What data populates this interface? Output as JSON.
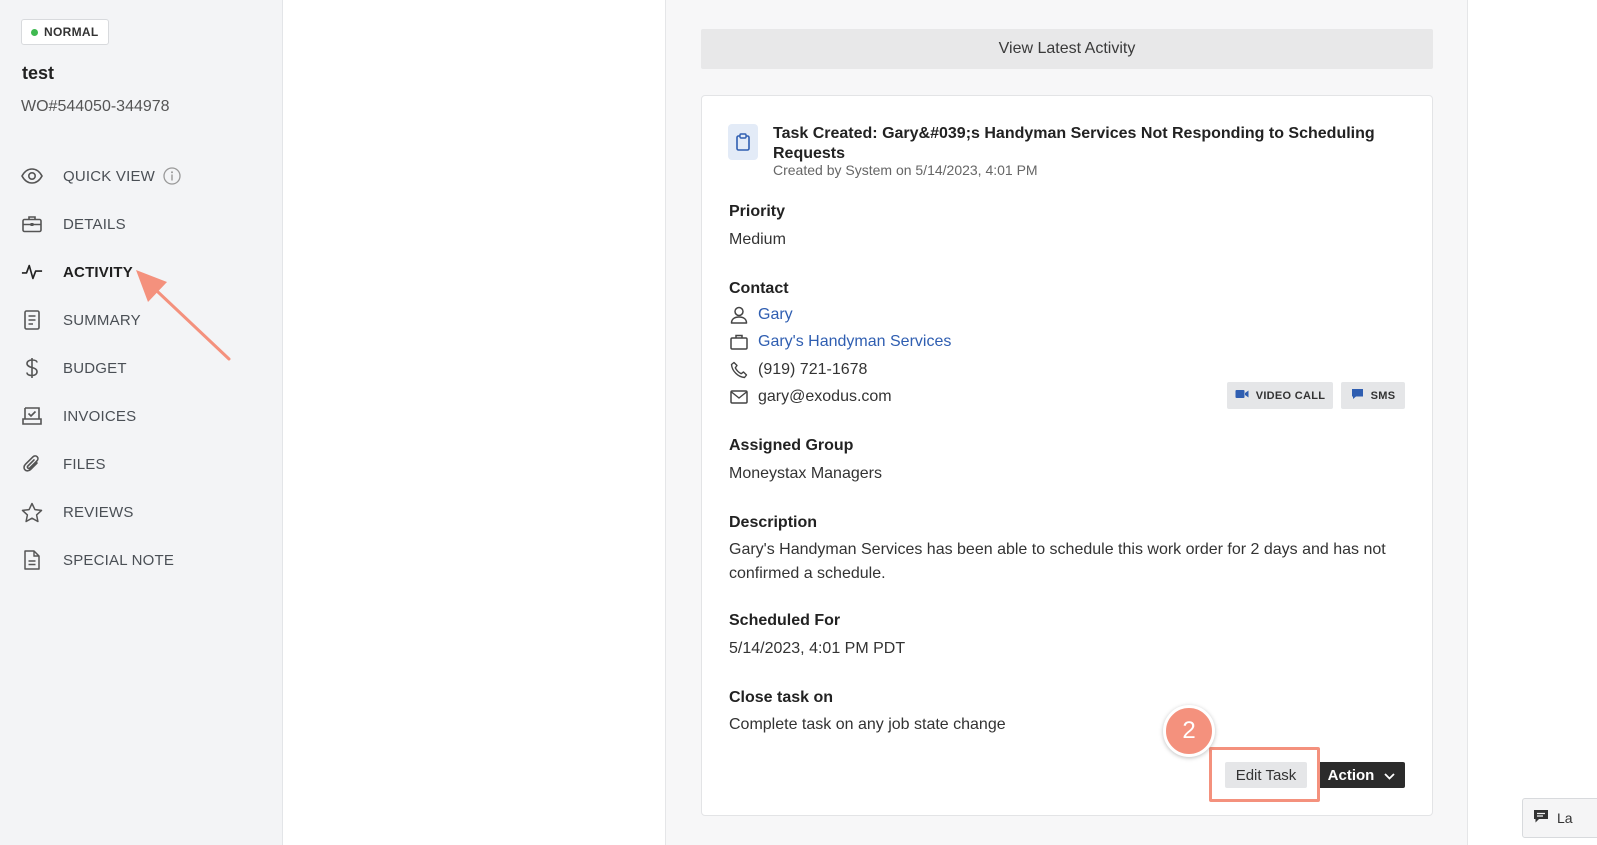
{
  "status_badge": {
    "label": "NORMAL",
    "color": "#3fb950"
  },
  "work_order": {
    "title": "test",
    "number": "WO#544050-344978"
  },
  "nav": {
    "items": [
      {
        "label": "QUICK VIEW",
        "icon": "eye-icon"
      },
      {
        "label": "DETAILS",
        "icon": "briefcase-icon"
      },
      {
        "label": "ACTIVITY",
        "icon": "activity-pulse-icon",
        "active": true
      },
      {
        "label": "SUMMARY",
        "icon": "document-lines-icon"
      },
      {
        "label": "BUDGET",
        "icon": "dollar-icon"
      },
      {
        "label": "INVOICES",
        "icon": "inbox-check-icon"
      },
      {
        "label": "FILES",
        "icon": "paperclip-icon"
      },
      {
        "label": "REVIEWS",
        "icon": "star-icon"
      },
      {
        "label": "SPECIAL NOTE",
        "icon": "file-text-icon"
      }
    ]
  },
  "activity": {
    "view_latest_label": "View Latest Activity",
    "task": {
      "title": "Task Created: Gary&#039;s Handyman Services Not Responding to Scheduling Requests",
      "meta": "Created by System on 5/14/2023, 4:01 PM",
      "priority_label": "Priority",
      "priority_value": "Medium",
      "contact_label": "Contact",
      "contact": {
        "name": "Gary",
        "company": "Gary's Handyman Services",
        "phone": "(919) 721-1678",
        "email": "gary@exodus.com"
      },
      "video_call_label": "VIDEO CALL",
      "sms_label": "SMS",
      "assigned_group_label": "Assigned Group",
      "assigned_group_value": "Moneystax Managers",
      "description_label": "Description",
      "description_value": "Gary's Handyman Services has been able to schedule this work order for 2 days and has not confirmed a schedule.",
      "scheduled_label": "Scheduled For",
      "scheduled_value": "5/14/2023, 4:01 PM PDT",
      "close_label": "Close task on",
      "close_value": "Complete task on any job state change",
      "edit_label": "Edit Task",
      "action_label": "Action"
    }
  },
  "annotation": {
    "step_number": "2",
    "color": "#f4917d"
  },
  "chat": {
    "label": "La"
  },
  "colors": {
    "link": "#2f5eb1",
    "accent_annotation": "#f4917d",
    "dark_button": "#2b2b2b"
  }
}
